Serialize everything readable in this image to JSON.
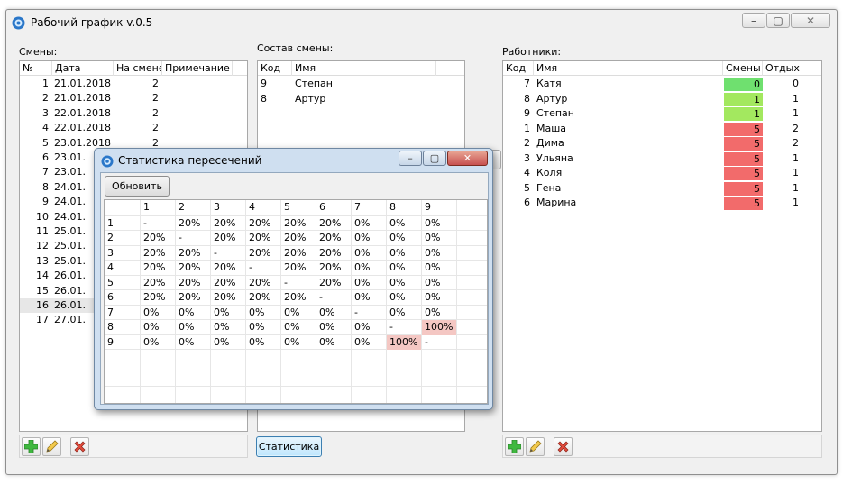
{
  "main": {
    "title": "Рабочий график  v.0.5",
    "shifts_label": "Смены:",
    "crew_label": "Состав смены:",
    "workers_label": "Работники:",
    "stats_button": "Статистика",
    "window_controls": {
      "minimize": "–",
      "maximize": "▢",
      "close": "✕"
    }
  },
  "shifts": {
    "columns": [
      "№",
      "Дата",
      "На смене",
      "Примечание"
    ],
    "rows": [
      {
        "n": "1",
        "date": "21.01.2018",
        "count": "2"
      },
      {
        "n": "2",
        "date": "21.01.2018",
        "count": "2"
      },
      {
        "n": "3",
        "date": "22.01.2018",
        "count": "2"
      },
      {
        "n": "4",
        "date": "22.01.2018",
        "count": "2"
      },
      {
        "n": "5",
        "date": "23.01.2018",
        "count": "2"
      },
      {
        "n": "6",
        "date": "23.01.",
        "count": ""
      },
      {
        "n": "7",
        "date": "23.01.",
        "count": ""
      },
      {
        "n": "8",
        "date": "24.01.",
        "count": ""
      },
      {
        "n": "9",
        "date": "24.01.",
        "count": ""
      },
      {
        "n": "10",
        "date": "24.01.",
        "count": ""
      },
      {
        "n": "11",
        "date": "25.01.",
        "count": ""
      },
      {
        "n": "12",
        "date": "25.01.",
        "count": ""
      },
      {
        "n": "13",
        "date": "25.01.",
        "count": ""
      },
      {
        "n": "14",
        "date": "26.01.",
        "count": ""
      },
      {
        "n": "15",
        "date": "26.01.",
        "count": ""
      },
      {
        "n": "16",
        "date": "26.01.",
        "count": ""
      },
      {
        "n": "17",
        "date": "27.01.",
        "count": ""
      }
    ]
  },
  "crew": {
    "columns": [
      "Код",
      "Имя"
    ],
    "rows": [
      {
        "code": "9",
        "name": "Степан"
      },
      {
        "code": "8",
        "name": "Артур"
      }
    ]
  },
  "workers": {
    "columns": [
      "Код",
      "Имя",
      "Смены",
      "Отдых"
    ],
    "rows": [
      {
        "code": "7",
        "name": "Катя",
        "shifts": "0",
        "rest": "0",
        "color": "#6fe06f"
      },
      {
        "code": "8",
        "name": "Артур",
        "shifts": "1",
        "rest": "1",
        "color": "#a3e85f"
      },
      {
        "code": "9",
        "name": "Степан",
        "shifts": "1",
        "rest": "1",
        "color": "#a3e85f"
      },
      {
        "code": "1",
        "name": "Маша",
        "shifts": "5",
        "rest": "2",
        "color": "#f26b6b"
      },
      {
        "code": "2",
        "name": "Дима",
        "shifts": "5",
        "rest": "2",
        "color": "#f26b6b"
      },
      {
        "code": "3",
        "name": "Ульяна",
        "shifts": "5",
        "rest": "1",
        "color": "#f26b6b"
      },
      {
        "code": "4",
        "name": "Коля",
        "shifts": "5",
        "rest": "1",
        "color": "#f26b6b"
      },
      {
        "code": "5",
        "name": "Гена",
        "shifts": "5",
        "rest": "1",
        "color": "#f26b6b"
      },
      {
        "code": "6",
        "name": "Марина",
        "shifts": "5",
        "rest": "1",
        "color": "#f26b6b"
      }
    ]
  },
  "popup": {
    "title": "Статистика пересечений",
    "refresh_button": "Обновить",
    "headers": [
      "1",
      "2",
      "3",
      "4",
      "5",
      "6",
      "7",
      "8",
      "9"
    ],
    "row_labels": [
      "1",
      "2",
      "3",
      "4",
      "5",
      "6",
      "7",
      "8",
      "9"
    ],
    "matrix": [
      [
        "-",
        "20%",
        "20%",
        "20%",
        "20%",
        "20%",
        "0%",
        "0%",
        "0%"
      ],
      [
        "20%",
        "-",
        "20%",
        "20%",
        "20%",
        "20%",
        "0%",
        "0%",
        "0%"
      ],
      [
        "20%",
        "20%",
        "-",
        "20%",
        "20%",
        "20%",
        "0%",
        "0%",
        "0%"
      ],
      [
        "20%",
        "20%",
        "20%",
        "-",
        "20%",
        "20%",
        "0%",
        "0%",
        "0%"
      ],
      [
        "20%",
        "20%",
        "20%",
        "20%",
        "-",
        "20%",
        "0%",
        "0%",
        "0%"
      ],
      [
        "20%",
        "20%",
        "20%",
        "20%",
        "20%",
        "-",
        "0%",
        "0%",
        "0%"
      ],
      [
        "0%",
        "0%",
        "0%",
        "0%",
        "0%",
        "0%",
        "-",
        "0%",
        "0%"
      ],
      [
        "0%",
        "0%",
        "0%",
        "0%",
        "0%",
        "0%",
        "0%",
        "-",
        "100%"
      ],
      [
        "0%",
        "0%",
        "0%",
        "0%",
        "0%",
        "0%",
        "0%",
        "100%",
        "-"
      ]
    ],
    "highlight_color": "#f4c7c3"
  },
  "toolbar": {
    "icons": [
      "add-icon",
      "edit-icon",
      "delete-icon"
    ]
  }
}
